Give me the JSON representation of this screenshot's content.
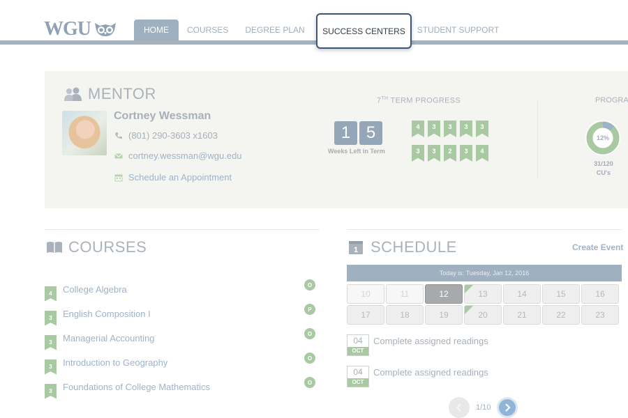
{
  "brand": {
    "logo_text": "WGU",
    "logo_icon": "owl-icon"
  },
  "nav": {
    "items": [
      {
        "label": "HOME",
        "state": "active"
      },
      {
        "label": "COURSES"
      },
      {
        "label": "DEGREE PLAN"
      },
      {
        "label": "SUCCESS CENTERS",
        "state": "focused"
      },
      {
        "label": "STUDENT SUPPORT"
      }
    ]
  },
  "mentor": {
    "heading": "MENTOR",
    "name": "Cortney Wessman",
    "phone": "(801) 290-3603 x1603",
    "email": "cortney.wessman@wgu.edu",
    "appointment": "Schedule an Appointment"
  },
  "term": {
    "title_prefix": "7",
    "title_sup": "TH",
    "title_suffix": " TERM PROGRESS",
    "weeks_digits": [
      "1",
      "5"
    ],
    "weeks_label": "Weeks Left in Term",
    "flags_row1": [
      "4",
      "3",
      "3",
      "3",
      "3"
    ],
    "flags_row2": [
      "3",
      "3",
      "2",
      "3",
      "4"
    ]
  },
  "program": {
    "title": "PROGRA",
    "percent_label": "12%",
    "percent_value": 12,
    "cu_text": "31/120",
    "cu_label": "CU's"
  },
  "courses": {
    "heading": "COURSES",
    "items": [
      {
        "units": "4",
        "name": "College Algebra",
        "status": "O"
      },
      {
        "units": "3",
        "name": "English Composition I",
        "status": "P"
      },
      {
        "units": "3",
        "name": "Managerial Accounting",
        "status": "O"
      },
      {
        "units": "3",
        "name": "Introduction to Geography",
        "status": "O"
      },
      {
        "units": "3",
        "name": "Foundations of College Mathematics",
        "status": "O"
      }
    ]
  },
  "schedule": {
    "heading": "SCHEDULE",
    "create_event": "Create Event",
    "today_text": "Today is: Tuesday, Jan 12, 2016",
    "days": [
      {
        "n": "10",
        "state": "past"
      },
      {
        "n": "11",
        "state": "past"
      },
      {
        "n": "12",
        "state": "today"
      },
      {
        "n": "13",
        "state": "event"
      },
      {
        "n": "14"
      },
      {
        "n": "15"
      },
      {
        "n": "16"
      },
      {
        "n": "17"
      },
      {
        "n": "18"
      },
      {
        "n": "19"
      },
      {
        "n": "20",
        "state": "event"
      },
      {
        "n": "21"
      },
      {
        "n": "22"
      },
      {
        "n": "23"
      }
    ],
    "events": [
      {
        "day": "04",
        "month": "OCT",
        "title": "Complete assigned readings"
      },
      {
        "day": "04",
        "month": "OCT",
        "title": "Complete assigned readings"
      }
    ],
    "pager": {
      "text": "1/10",
      "prev_icon": "chevron-left-icon",
      "next_icon": "chevron-right-icon"
    }
  },
  "colors": {
    "accent": "#9fb0c0",
    "green": "#a9c9a2",
    "link": "#9fb3c8",
    "focus": "#3d5573"
  }
}
